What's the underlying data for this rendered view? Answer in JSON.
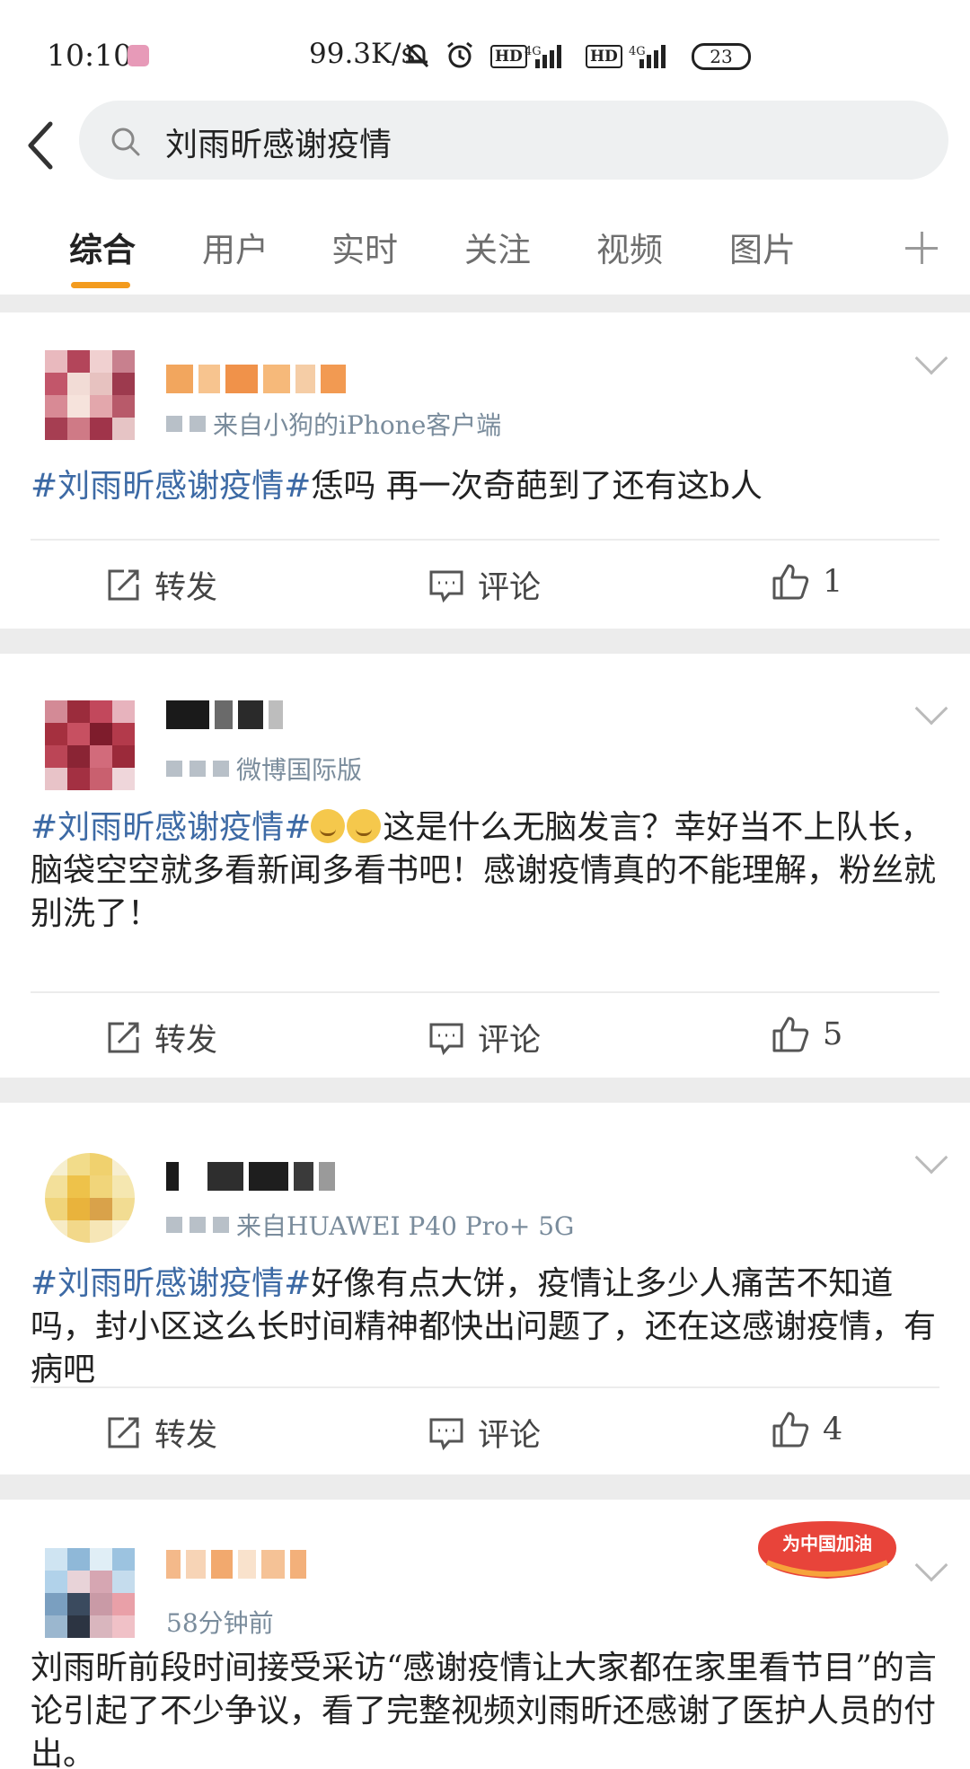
{
  "status_bar": {
    "time": "10:10",
    "speed": "99.3K/s",
    "hd1": "HD",
    "net1": "4G",
    "hd2": "HD",
    "net2": "4G",
    "battery": "23"
  },
  "search": {
    "query": "刘雨昕感谢疫情"
  },
  "tabs": [
    {
      "label": "综合",
      "active": true
    },
    {
      "label": "用户"
    },
    {
      "label": "实时"
    },
    {
      "label": "关注"
    },
    {
      "label": "视频"
    },
    {
      "label": "图片"
    }
  ],
  "actions": {
    "repost": "转发",
    "comment": "评论"
  },
  "posts": [
    {
      "source": "来自小狗的iPhone客户端",
      "hashtag": "#刘雨昕感谢疫情#",
      "text": "恁吗 再一次奇葩到了还有这b人",
      "likes": "1"
    },
    {
      "source": "微博国际版",
      "hashtag": "#刘雨昕感谢疫情#",
      "text": "这是什么无脑发言？幸好当不上队长，脑袋空空就多看新闻多看书吧！感谢疫情真的不能理解，粉丝就别洗了！",
      "likes": "5"
    },
    {
      "source": "来自HUAWEI P40 Pro+ 5G",
      "hashtag": "#刘雨昕感谢疫情#",
      "text": "好像有点大饼，疫情让多少人痛苦不知道吗，封小区这么长时间精神都快出问题了，还在这感谢疫情，有病吧",
      "likes": "4"
    },
    {
      "source": "58分钟前",
      "badge": "为中国加油",
      "text": "刘雨昕前段时间接受采访“感谢疫情让大家都在家里看节目”的言论引起了不少争议，看了完整视频刘雨昕还感谢了医护人员的付出。"
    }
  ],
  "colors": {
    "accent": "#f39b1e",
    "hashtag": "#3d6aa5",
    "text": "#222222",
    "muted": "#7a8c9c"
  }
}
